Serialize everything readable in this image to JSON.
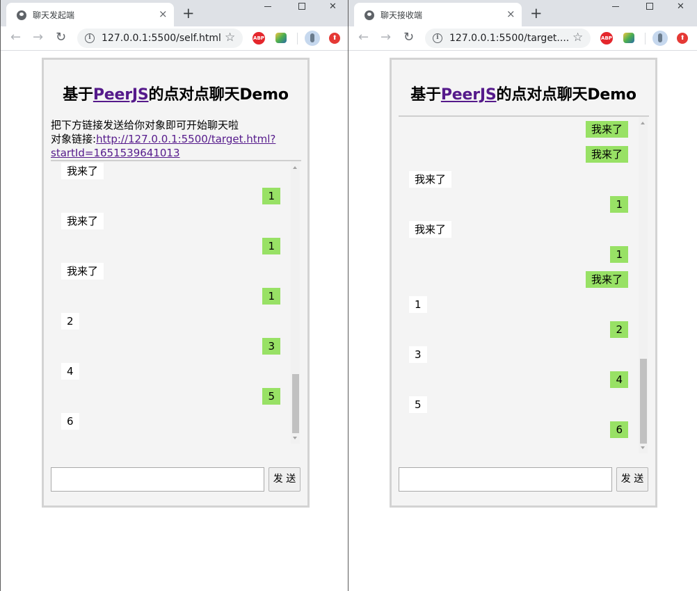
{
  "left": {
    "tab_title": "聊天发起端",
    "url": "127.0.0.1:5500/self.html",
    "title_prefix": "基于",
    "title_link": "PeerJS",
    "title_suffix": "的点对点聊天Demo",
    "intro_line": "把下方链接发送给你对象即可开始聊天啦",
    "link_label": "对象链接:",
    "link_url_part1": "http://127.0.0.1:5500/target.html?",
    "link_url_part2": "startId=1651539641013",
    "messages": [
      {
        "dir": "in",
        "text": "我来了"
      },
      {
        "dir": "out",
        "text": "1"
      },
      {
        "dir": "in",
        "text": "我来了"
      },
      {
        "dir": "out",
        "text": "1"
      },
      {
        "dir": "in",
        "text": "我来了"
      },
      {
        "dir": "out",
        "text": "1"
      },
      {
        "dir": "in",
        "text": "2"
      },
      {
        "dir": "out",
        "text": "3"
      },
      {
        "dir": "in",
        "text": "4"
      },
      {
        "dir": "out",
        "text": "5"
      },
      {
        "dir": "in",
        "text": "6"
      }
    ],
    "input_value": "",
    "send_label": "发 送"
  },
  "right": {
    "tab_title": "聊天接收端",
    "url": "127.0.0.1:5500/target....",
    "title_prefix": "基于",
    "title_link": "PeerJS",
    "title_suffix": "的点对点聊天Demo",
    "messages": [
      {
        "dir": "out",
        "text": "我来了"
      },
      {
        "dir": "out",
        "text": "我来了"
      },
      {
        "dir": "in",
        "text": "我来了"
      },
      {
        "dir": "out",
        "text": "1"
      },
      {
        "dir": "in",
        "text": "我来了"
      },
      {
        "dir": "out",
        "text": "1"
      },
      {
        "dir": "out",
        "text": "我来了"
      },
      {
        "dir": "in",
        "text": "1"
      },
      {
        "dir": "out",
        "text": "2"
      },
      {
        "dir": "in",
        "text": "3"
      },
      {
        "dir": "out",
        "text": "4"
      },
      {
        "dir": "in",
        "text": "5"
      },
      {
        "dir": "out",
        "text": "6"
      }
    ],
    "input_value": "",
    "send_label": "发 送"
  },
  "browser": {
    "close_glyph": "×",
    "newtab_glyph": "+",
    "back_glyph": "←",
    "forward_glyph": "→",
    "reload_glyph": "↻",
    "star_glyph": "☆",
    "info_glyph": "i",
    "abp_label": "ABP",
    "update_glyph": "⬆",
    "window_close_glyph": "✕"
  }
}
